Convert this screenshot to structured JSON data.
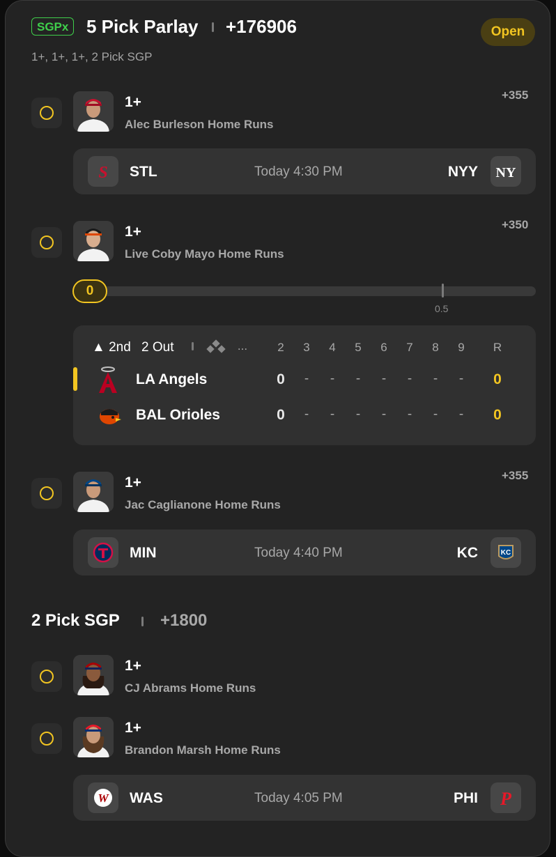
{
  "parlay": {
    "badge": "SGPx",
    "title": "5 Pick Parlay",
    "odds": "+176906",
    "subtitle": "1+, 1+, 1+, 2 Pick SGP",
    "status": "Open"
  },
  "picks": [
    {
      "line": "1+",
      "description": "Alec Burleson Home Runs",
      "odds": "+355",
      "jersey_color": "#c8102e"
    },
    {
      "line": "1+",
      "description": "Live Coby Mayo Home Runs",
      "odds": "+350",
      "jersey_color": "#df4601"
    },
    {
      "line": "1+",
      "description": "Jac Caglianone Home Runs",
      "odds": "+355",
      "jersey_color": "#004687"
    }
  ],
  "games": [
    {
      "away": "STL",
      "time": "Today 4:30 PM",
      "home": "NYY"
    },
    {
      "away": "MIN",
      "time": "Today 4:40 PM",
      "home": "KC"
    }
  ],
  "live_tracker": {
    "current": "0",
    "target": "0.5",
    "progress": 0
  },
  "scoreboard": {
    "inning": "2nd",
    "outs": "2 Out",
    "ellipsis": "...",
    "innings": [
      "2",
      "3",
      "4",
      "5",
      "6",
      "7",
      "8",
      "9"
    ],
    "runs_label": "R",
    "teams": [
      {
        "name": "LA Angels",
        "runs_by_inning": [
          "0",
          "-",
          "-",
          "-",
          "-",
          "-",
          "-",
          "-"
        ],
        "total": "0",
        "batting": true
      },
      {
        "name": "BAL Orioles",
        "runs_by_inning": [
          "0",
          "-",
          "-",
          "-",
          "-",
          "-",
          "-",
          "-"
        ],
        "total": "0",
        "batting": false
      }
    ]
  },
  "sgp": {
    "title": "2 Pick SGP",
    "odds": "+1800",
    "picks": [
      {
        "line": "1+",
        "description": "CJ Abrams Home Runs"
      },
      {
        "line": "1+",
        "description": "Brandon Marsh Home Runs"
      }
    ],
    "game": {
      "away": "WAS",
      "time": "Today 4:05 PM",
      "home": "PHI"
    }
  },
  "colors": {
    "accent": "#f2c521",
    "sgpx_green": "#3fcf4b",
    "background": "#232323"
  }
}
